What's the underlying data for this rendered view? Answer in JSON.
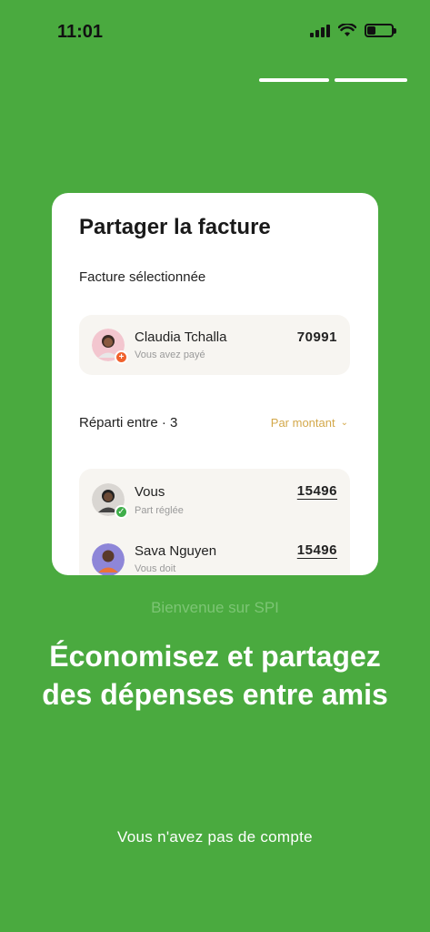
{
  "status_bar": {
    "time": "11:01"
  },
  "onboarding": {
    "steps_total": 2,
    "step_current": 2
  },
  "card": {
    "title": "Partager la facture",
    "subtitle": "Facture sélectionnée",
    "bill": {
      "name": "Claudia Tchalla",
      "sub": "Vous avez payé",
      "amount": "70991"
    },
    "split_label": "Réparti entre · 3",
    "split_mode": "Par montant",
    "members": [
      {
        "name": "Vous",
        "sub": "Part réglée",
        "amount": "15496"
      },
      {
        "name": "Sava Nguyen",
        "sub": "Vous doit",
        "amount": "15496"
      }
    ]
  },
  "welcome": "Bienvenue sur SPI",
  "headline_line1": "Économisez et partagez",
  "headline_line2": "des dépenses entre amis",
  "no_account": "Vous n'avez pas de compte",
  "colors": {
    "background": "#4aaa3f",
    "accent": "#d3a84a",
    "badge_orange": "#f0622d",
    "badge_green": "#3fae4a"
  },
  "icons": {
    "signal": "signal-icon",
    "wifi": "wifi-icon",
    "battery": "battery-icon",
    "chevron": "chevron-down-icon"
  }
}
